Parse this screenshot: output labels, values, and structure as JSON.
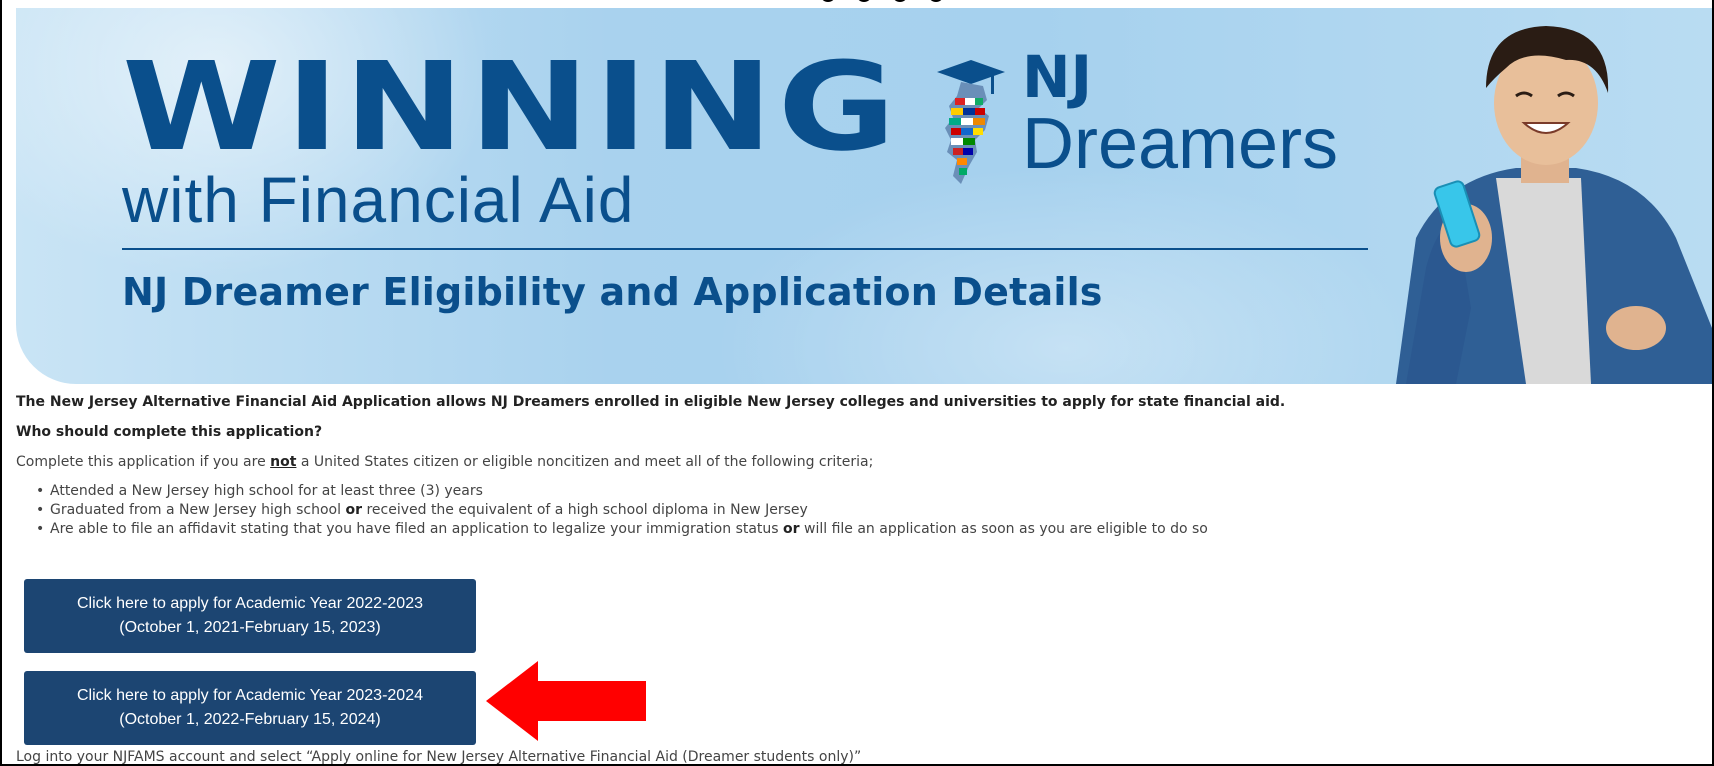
{
  "banner": {
    "headline": "WINNING",
    "tagline": "with Financial Aid",
    "logo_nj": "NJ",
    "logo_dreamers": "Dreamers",
    "subtitle": "NJ Dreamer Eligibility and Application Details",
    "logo_icon": "nj-state-graduation-cap-icon"
  },
  "content": {
    "intro": "The New Jersey Alternative Financial Aid Application allows NJ Dreamers enrolled in eligible New Jersey colleges and universities to apply for state financial aid.",
    "who_heading": "Who should complete this application?",
    "complete_prefix": "Complete this application if you are ",
    "complete_emph": "not",
    "complete_suffix": " a United States citizen or eligible noncitizen and meet all of the following criteria;",
    "criteria": [
      {
        "pre": "Attended a New Jersey high school for at least three (3) years",
        "emph": "",
        "post": ""
      },
      {
        "pre": "Graduated from a New Jersey high school ",
        "emph": "or",
        "post": " received the equivalent of a high school diploma in New Jersey"
      },
      {
        "pre": "Are able to file an affidavit stating that you have filed an application to legalize your immigration status ",
        "emph": "or",
        "post": " will file an application as soon as you are eligible to do so"
      }
    ],
    "buttons": [
      {
        "line1": "Click here to apply for Academic Year 2022-2023",
        "line2": "(October 1, 2021-February 15, 2023)"
      },
      {
        "line1": "Click here to apply for Academic Year 2023-2024",
        "line2": "(October 1, 2022-February 15, 2024)"
      }
    ],
    "login_note": "Log into your NJFAMS account and select “Apply online for New Jersey Alternative Financial Aid (Dreamer students only)”"
  },
  "colors": {
    "brand_blue": "#0a4f8c",
    "button_bg": "#1c4572",
    "arrow": "#ff0000"
  }
}
